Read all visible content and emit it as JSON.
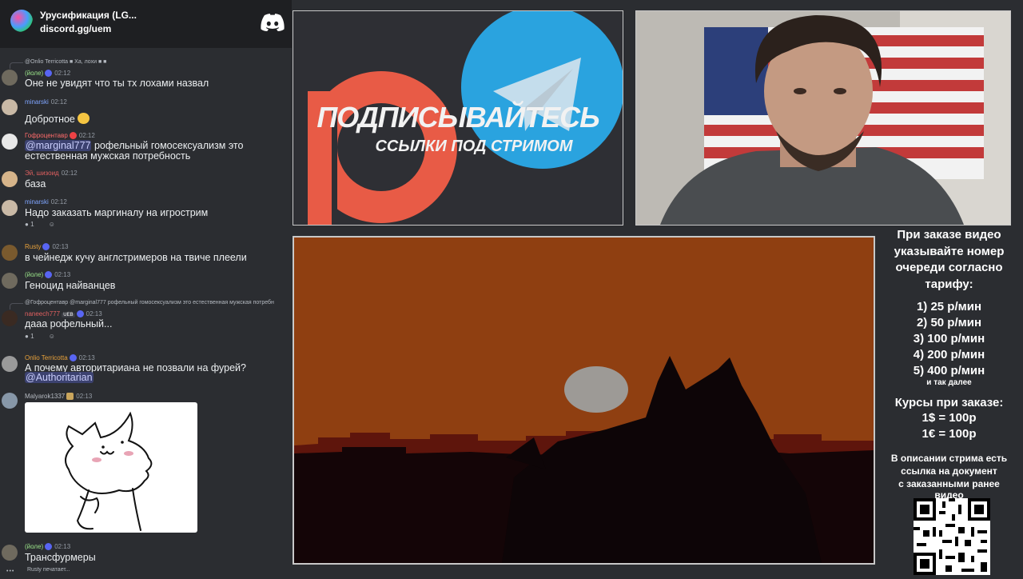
{
  "server": {
    "name": "Урусификация (LG...",
    "link": "discord.gg/uem"
  },
  "messages": [
    {
      "reply": "@Onlio Terricotta ■ Ха, лохи ■ ■",
      "author": "(йоле)",
      "time": "02:12",
      "text": "Оне не увидят что ты тх лохами назвал",
      "author_color": "#9be58a"
    },
    {
      "author": "minarski",
      "time": "02:12",
      "text": "Добротное",
      "author_color": "#7fa5ff"
    },
    {
      "author": "Гофроцентавр",
      "time": "02:12",
      "mention": "@marginal777",
      "text": "рофельный гомосексуализм это",
      "text2": "естественная мужская потребность",
      "author_color": "#ff6b6b"
    },
    {
      "author": "Эй, шизоид",
      "time": "02:12",
      "text": "база",
      "author_color": "#e06060"
    },
    {
      "author": "minarski",
      "time": "02:12",
      "text": "Надо заказать маргиналу на игрострим",
      "author_color": "#7fa5ff",
      "reactions": [
        "1",
        ""
      ]
    },
    {
      "author": "Rusty",
      "time": "02:13",
      "text": "в чейнедж кучу англстримеров на твиче плеели",
      "author_color": "#e9a23b"
    },
    {
      "author": "(йоле)",
      "time": "02:13",
      "text": "Геноцид найванцев",
      "author_color": "#9be58a"
    },
    {
      "reply": "@Гофроцентавр @marginal777 рофельный гомосексуализм это естественная мужская потребн",
      "author": "naneech777",
      "time": "02:13",
      "text": "дааа рофельный...",
      "author_color": "#e06060",
      "tag": "UEB",
      "reactions": [
        "1",
        ""
      ]
    },
    {
      "author": "Onlio Terricotta",
      "time": "02:13",
      "text": "А почему авторитариана не позвали на фурей?",
      "mention2": "@Authoritarian",
      "author_color": "#e9a23b"
    },
    {
      "author": "Malyarok1337",
      "time": "02:13",
      "author_color": "#b5bac1"
    },
    {
      "author": "(йоле)",
      "time": "02:13",
      "text": "Трансфурмеры",
      "author_color": "#9be58a"
    }
  ],
  "typing": "Rusty печатает...",
  "banner": {
    "title": "ПОДПИСЫВАЙТЕСЬ",
    "subtitle": "ССЫЛКИ ПОД СТРИМОМ"
  },
  "info": {
    "heading": [
      "При заказе видео",
      "указывайте номер",
      "очереди согласно",
      "тарифу:"
    ],
    "tariffs": [
      "1) 25 р/мин",
      "2) 50 р/мин",
      "3) 100 р/мин",
      "4) 200 р/мин",
      "5) 400 р/мин"
    ],
    "and_more": "и так далее",
    "rates_heading": "Курсы при заказе:",
    "rates": [
      "1$ = 100р",
      "1€ = 100р"
    ],
    "doc_note": [
      "В описании стрима есть",
      "ссылка на документ",
      "с заказанными ранее",
      "видео"
    ]
  },
  "colors": {
    "chat_bg": "#2b2d31",
    "mention_bg": "#3c4270",
    "blurple": "#5865f2",
    "patreon": "#e85b46",
    "telegram": "#2aa3df",
    "sky_orange": "#8f3f11"
  }
}
